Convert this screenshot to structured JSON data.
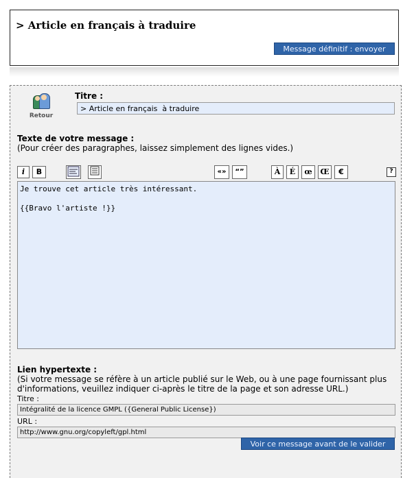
{
  "preview": {
    "title": "> Article en français à traduire",
    "send_button": "Message définitif : envoyer"
  },
  "form": {
    "retour_label": "Retour",
    "titre_label": "Titre :",
    "titre_value": "> Article en français  à traduire",
    "texte_label": "Texte de votre message :",
    "texte_hint": "(Pour créer des paragraphes, laissez simplement des lignes vides.)",
    "toolbar": {
      "italic": "i",
      "bold": "B",
      "quote": "«»",
      "quote2": "“”",
      "a_grave": "À",
      "e_acute": "É",
      "oe": "œ",
      "OE": "Œ",
      "euro": "€",
      "help": "?"
    },
    "message_text": "Je trouve cet article très intéressant.\n\n{{Bravo l'artiste !}}",
    "lien_label": "Lien hypertexte :",
    "lien_hint": "(Si votre message se réfère à un article publié sur le Web, ou à une page fournissant plus d'informations, veuillez indiquer ci-après le titre de la page et son adresse URL.)",
    "lien_titre_label": "Titre :",
    "lien_titre_value": "Intégralité de la licence GMPL ({General Public License})",
    "url_label": "URL :",
    "url_value": "http://www.gnu.org/copyleft/gpl.html",
    "preview_button": "Voir ce message avant de le valider"
  }
}
